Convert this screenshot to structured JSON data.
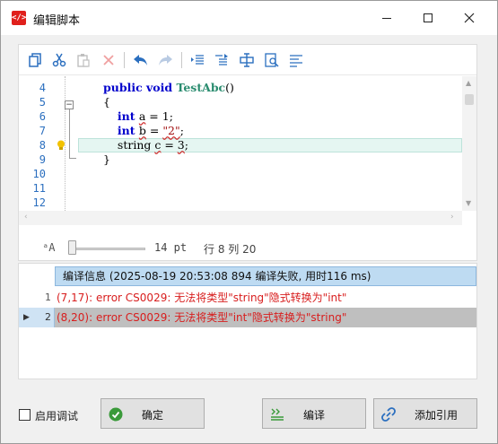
{
  "window": {
    "title": "编辑脚本",
    "app_icon": "</>"
  },
  "toolbar": {
    "buttons": [
      "copy-icon",
      "cut-icon",
      "paste-icon",
      "delete-icon",
      "undo-icon",
      "redo-icon",
      "outdent-icon",
      "indent-icon",
      "comment-icon",
      "find-icon",
      "format-icon"
    ]
  },
  "editor": {
    "line_numbers": [
      "4",
      "5",
      "6",
      "7",
      "8",
      "9",
      "10",
      "11",
      "12"
    ],
    "lines": [
      {
        "indent": "",
        "tokens": [
          [
            "kw",
            "public "
          ],
          [
            "kw",
            "void "
          ],
          [
            "fn",
            "TestAbc"
          ],
          [
            "",
            "()"
          ]
        ]
      },
      {
        "indent": "",
        "tokens": [
          [
            "",
            "{"
          ]
        ]
      },
      {
        "indent": "    ",
        "tokens": [
          [
            "ty",
            "int "
          ],
          [
            "err",
            "a"
          ],
          [
            "",
            " = 1;"
          ]
        ]
      },
      {
        "indent": "    ",
        "tokens": [
          [
            "ty",
            "int "
          ],
          [
            "err",
            "b"
          ],
          [
            "",
            " = "
          ],
          [
            "str",
            "\"2\""
          ],
          [
            "",
            ";"
          ]
        ]
      },
      {
        "indent": "    ",
        "tokens": [
          [
            "",
            "string "
          ],
          [
            "err",
            "c"
          ],
          [
            "",
            " = "
          ],
          [
            "err",
            "3"
          ],
          [
            "",
            ";"
          ]
        ]
      },
      {
        "indent": "",
        "tokens": [
          [
            "",
            "}"
          ]
        ]
      },
      {
        "indent": "",
        "tokens": []
      },
      {
        "indent": "",
        "tokens": []
      },
      {
        "indent": "",
        "tokens": []
      }
    ],
    "fold_marker": "−"
  },
  "zoom": {
    "icon_label": "ᵃA",
    "font_size": "14 pt",
    "position": "行 8 列 20"
  },
  "output": {
    "header": "编译信息 (2025-08-19 20:53:08 894 编译失败, 用时116 ms)",
    "rows": [
      {
        "num": "1",
        "msg": "(7,17): error CS0029: 无法将类型\"string\"隐式转换为\"int\""
      },
      {
        "num": "2",
        "msg": "(8,20): error CS0029: 无法将类型\"int\"隐式转换为\"string\""
      }
    ]
  },
  "footer": {
    "debug_label": "启用调试",
    "ok_label": "确定",
    "compile_label": "编译",
    "add_ref_label": "添加引用"
  },
  "colors": {
    "accent": "#2b6fbf",
    "error": "#d81e1e",
    "selection": "#bedbf2",
    "ok_green": "#3a9a3a"
  }
}
